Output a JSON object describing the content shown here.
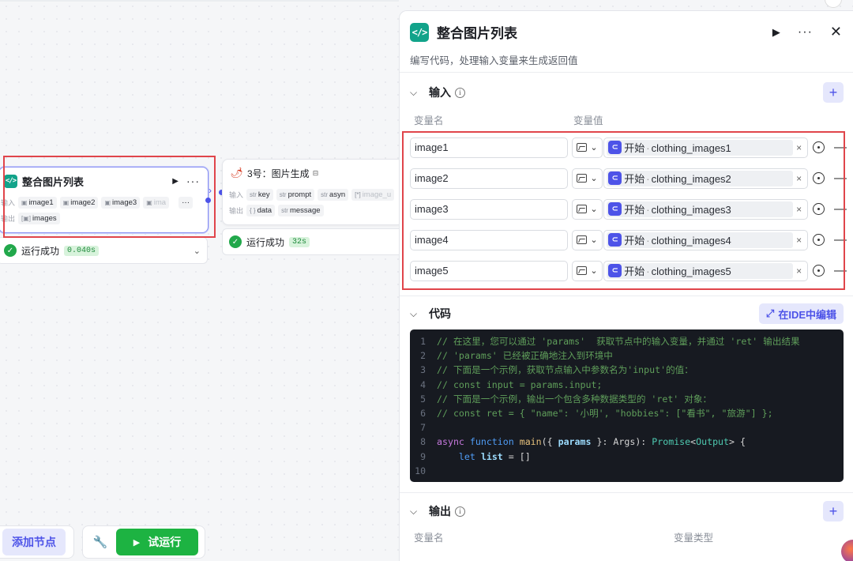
{
  "canvas": {
    "node1": {
      "title": "整合图片列表",
      "input_label": "输入",
      "output_label": "输出",
      "inputs": [
        "image1",
        "image2",
        "image3",
        "ima"
      ],
      "more": "···",
      "outputs": [
        "images"
      ],
      "status": "运行成功",
      "time": "0.040s"
    },
    "node2": {
      "title": "3号：图片生成",
      "input_label": "输入",
      "output_label": "输出",
      "inputs": [
        {
          "type": "str",
          "name": "key"
        },
        {
          "type": "str",
          "name": "prompt"
        },
        {
          "type": "str",
          "name": "asyn"
        },
        {
          "type": "[*]",
          "name": "image_u"
        }
      ],
      "outputs": [
        {
          "type": "{ }",
          "name": "data"
        },
        {
          "type": "str",
          "name": "message"
        }
      ],
      "status": "运行成功",
      "time": "32s"
    }
  },
  "toolbar": {
    "add_node": "添加节点",
    "test_run": "试运行"
  },
  "panel": {
    "title": "整合图片列表",
    "description": "编写代码，处理输入变量来生成返回值",
    "input_section": {
      "title": "输入",
      "col_name": "变量名",
      "col_value": "变量值",
      "rows": [
        {
          "name": "image1",
          "source": "开始",
          "ref": "clothing_images1"
        },
        {
          "name": "image2",
          "source": "开始",
          "ref": "clothing_images2"
        },
        {
          "name": "image3",
          "source": "开始",
          "ref": "clothing_images3"
        },
        {
          "name": "image4",
          "source": "开始",
          "ref": "clothing_images4"
        },
        {
          "name": "image5",
          "source": "开始",
          "ref": "clothing_images5"
        }
      ]
    },
    "code_section": {
      "title": "代码",
      "ide_button": "在IDE中编辑",
      "line_numbers": [
        "1",
        "2",
        "3",
        "4",
        "5",
        "6",
        "7",
        "8",
        "9",
        "10"
      ],
      "lines": [
        "// 在这里，您可以通过 'params'  获取节点中的输入变量，并通过 'ret' 输出结果",
        "// 'params' 已经被正确地注入到环境中",
        "// 下面是一个示例，获取节点输入中参数名为'input'的值：",
        "// const input = params.input;",
        "// 下面是一个示例，输出一个包含多种数据类型的 'ret' 对象：",
        "// const ret = { \"name\": '小明', \"hobbies\": [\"看书\", \"旅游\"] };",
        "",
        "async function main({ params }: Args): Promise<Output> {",
        "    let list = []",
        ""
      ]
    },
    "output_section": {
      "title": "输出",
      "col_name": "变量名",
      "col_type": "变量类型"
    }
  },
  "colors": {
    "accent": "#4d53e8",
    "success": "#1db342",
    "highlight_box": "#e0454b",
    "code_bg": "#171a21"
  }
}
